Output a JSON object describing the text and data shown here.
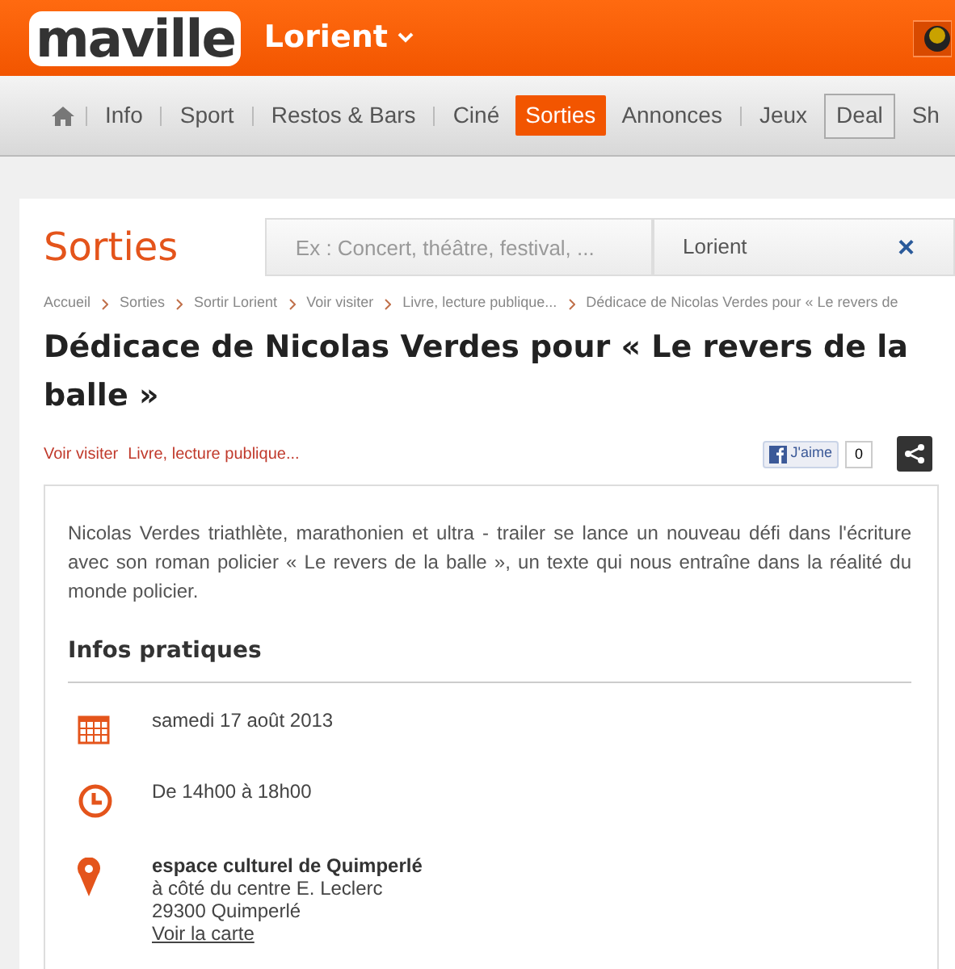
{
  "header": {
    "logo": "maville",
    "city": "Lorient"
  },
  "nav": [
    {
      "kind": "home",
      "selected": false
    },
    {
      "kind": "link",
      "label": "Info",
      "selected": false
    },
    {
      "kind": "link",
      "label": "Sport",
      "selected": false
    },
    {
      "kind": "link",
      "label": "Restos & Bars",
      "selected": false
    },
    {
      "kind": "link",
      "label": "Ciné",
      "selected": false
    },
    {
      "kind": "link",
      "label": "Sorties",
      "selected": true
    },
    {
      "kind": "link",
      "label": "Annonces",
      "selected": false
    },
    {
      "kind": "link",
      "label": "Jeux",
      "selected": false
    },
    {
      "kind": "boxed",
      "label": "Deal",
      "selected": false
    },
    {
      "kind": "link",
      "label": "Sh",
      "selected": false
    }
  ],
  "section_title": "Sorties",
  "search": {
    "placeholder": "Ex : Concert, théâtre, festival, ...",
    "location": "Lorient",
    "clear": "×"
  },
  "breadcrumb": [
    "Accueil",
    "Sorties",
    "Sortir Lorient",
    "Voir visiter",
    "Livre, lecture publique...",
    "Dédicace de Nicolas Verdes pour « Le revers de"
  ],
  "title": "Dédicace de Nicolas Verdes pour « Le revers de la balle »",
  "tags": [
    "Voir visiter",
    "Livre, lecture publique..."
  ],
  "like": {
    "label": "J'aime",
    "count": "0"
  },
  "description": "Nicolas Verdes triathlète, marathonien et ultra - trailer se lance un nouveau défi dans l'écriture avec son roman policier « Le revers de la balle », un texte qui nous entraîne dans la réalité du monde policier.",
  "infos_title": "Infos pratiques",
  "infos": [
    {
      "kind": "date",
      "lines": [
        "samedi 17 août 2013"
      ]
    },
    {
      "kind": "time",
      "lines": [
        "De 14h00 à 18h00"
      ]
    },
    {
      "kind": "place",
      "name": "espace culturel de Quimperlé",
      "lines": [
        "à côté du centre E. Leclerc",
        "29300 Quimperlé"
      ],
      "link": "Voir la carte"
    }
  ]
}
